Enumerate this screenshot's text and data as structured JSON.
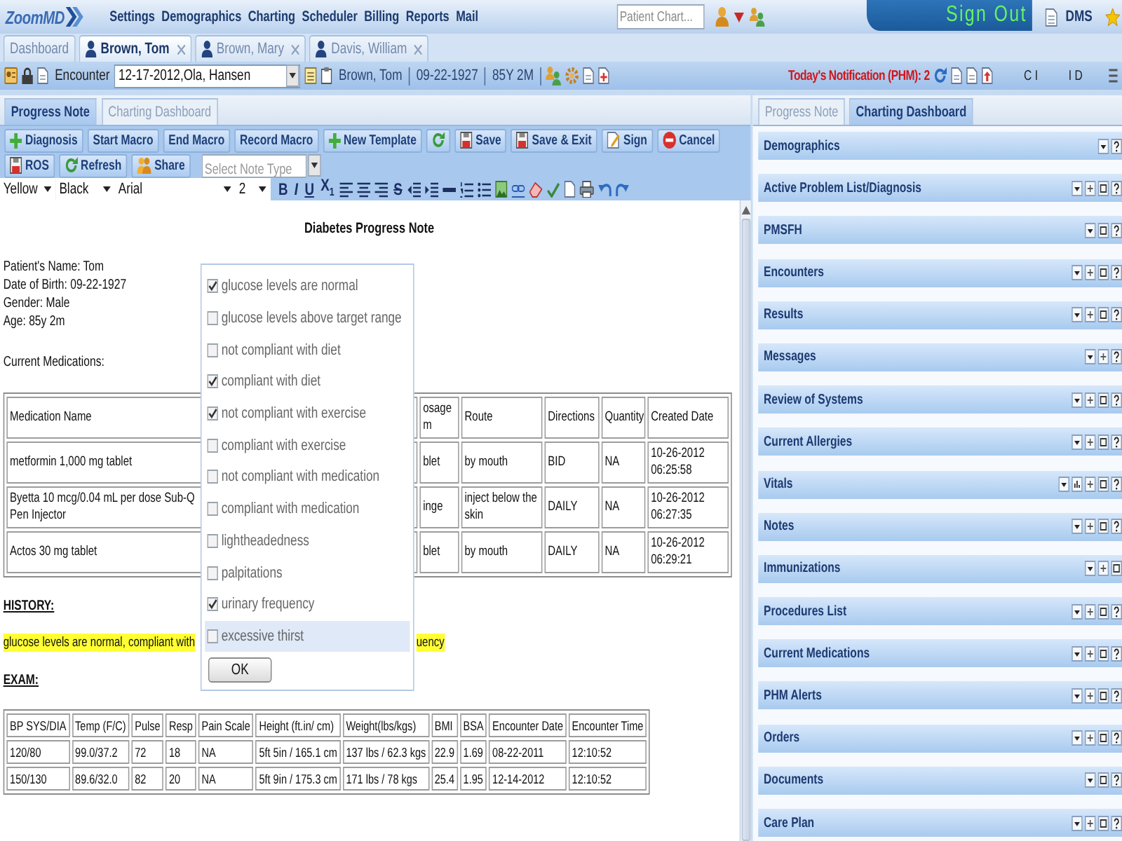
{
  "header": {
    "logo": "ZoomMD",
    "nav": [
      "Settings",
      "Demographics",
      "Charting",
      "Scheduler",
      "Billing",
      "Reports",
      "Mail"
    ],
    "search": {
      "placeholder": "Patient Chart..."
    },
    "sign_out": "Sign Out",
    "user": "DMS"
  },
  "patient_tabs": [
    {
      "label": "Dashboard",
      "kind": "dashboard",
      "selected": false
    },
    {
      "label": "Brown, Tom",
      "kind": "patient",
      "selected": true
    },
    {
      "label": "Brown, Mary",
      "kind": "patient",
      "selected": false
    },
    {
      "label": "Davis, William",
      "kind": "patient",
      "selected": false
    }
  ],
  "encounter_bar": {
    "label": "Encounter",
    "encounter": "12-17-2012,Ola, Hansen",
    "patient": "Brown, Tom",
    "birth_date": "09-22-1927",
    "age": "85Y 2M",
    "notification": "Today's Notification (PHM): 2",
    "codes": [
      "C I",
      "I D"
    ]
  },
  "note_tabs": [
    {
      "label": "Progress Note",
      "selected": true
    },
    {
      "label": "Charting Dashboard",
      "selected": false
    }
  ],
  "toolbar": [
    [
      {
        "label": "Diagnosis",
        "kind": "add"
      },
      {
        "label": "Start Macro",
        "kind": "plain"
      },
      {
        "label": "End Macro",
        "kind": "plain"
      },
      {
        "label": "Record Macro",
        "kind": "plain"
      },
      {
        "label": "New Template",
        "kind": "add"
      },
      {
        "kind": "reload"
      },
      {
        "label": "Save",
        "kind": "save"
      },
      {
        "label": "Save & Exit",
        "kind": "save"
      },
      {
        "label": "Sign",
        "kind": "sign"
      },
      {
        "label": "Cancel",
        "kind": "cancel"
      }
    ],
    [
      {
        "label": "ROS",
        "kind": "save"
      },
      {
        "label": "Refresh",
        "kind": "refresh"
      },
      {
        "label": "Share",
        "kind": "share"
      }
    ]
  ],
  "note_type": {
    "placeholder": "Select Note Type"
  },
  "format_bar": {
    "highlight": "Yellow",
    "text_color": "Black",
    "font": "Arial",
    "size": "2",
    "tools": [
      {
        "kind": "bold",
        "label": "B"
      },
      {
        "kind": "italic",
        "label": "I"
      },
      {
        "kind": "underline",
        "label": "U"
      },
      {
        "kind": "subscript",
        "label": "X$_{1}$"
      },
      {
        "kind": "align-left"
      },
      {
        "kind": "align-center"
      },
      {
        "kind": "align-right"
      },
      {
        "kind": "strike",
        "label": "S"
      },
      {
        "kind": "outdent"
      },
      {
        "kind": "indent"
      },
      {
        "kind": "rule"
      },
      {
        "kind": "numbered-list"
      },
      {
        "kind": "bullet-list"
      },
      {
        "kind": "image"
      },
      {
        "kind": "link"
      },
      {
        "kind": "clear-format"
      },
      {
        "kind": "spellcheck"
      },
      {
        "kind": "paste"
      },
      {
        "kind": "print"
      },
      {
        "kind": "undo"
      },
      {
        "kind": "redo"
      }
    ]
  },
  "document": {
    "title": "Diabetes Progress Note",
    "patient_info": [
      "Patient's Name: Tom",
      "Date of Birth: 09-22-1927",
      "Gender: Male",
      "Age: 85y 2m"
    ],
    "medications_label": "Current Medications:",
    "medications": {
      "columns": [
        "Medication Name",
        "osage m",
        "Route",
        "Directions",
        "Quantity",
        "Created Date"
      ],
      "rows": [
        [
          "metformin 1,000 mg tablet",
          "blet",
          "by mouth",
          "BID",
          "NA",
          "10-26-2012 06:25:58"
        ],
        [
          "Byetta 10 mcg/0.04 mL per dose Sub-Q Pen Injector",
          "inge",
          "inject below the skin",
          "DAILY",
          "NA",
          "10-26-2012 06:27:35"
        ],
        [
          "Actos 30 mg tablet",
          "blet",
          "by mouth",
          "DAILY",
          "NA",
          "10-26-2012 06:29:21"
        ]
      ]
    },
    "history_heading": "HISTORY:",
    "history_text": [
      "glucose levels are normal, compliant with",
      "uency"
    ],
    "exam_heading": "EXAM:",
    "vitals": {
      "columns": [
        "BP SYS/DIA",
        "Temp (F/C)",
        "Pulse",
        "Resp",
        "Pain Scale",
        "Height (ft.in/ cm)",
        "Weight(lbs/kgs)",
        "BMI",
        "BSA",
        "Encounter Date",
        "Encounter Time"
      ],
      "rows": [
        [
          "120/80",
          "99.0/37.2",
          "72",
          "18",
          "NA",
          "5ft 5in / 165.1 cm",
          "137 lbs / 62.3 kgs",
          "22.9",
          "1.69",
          "08-22-2011",
          "12:10:52"
        ],
        [
          "150/130",
          "89.6/32.0",
          "82",
          "20",
          "NA",
          "5ft 9in / 175.3 cm",
          "171 lbs / 78 kgs",
          "25.4",
          "1.95",
          "12-14-2012",
          "12:10:52"
        ]
      ]
    }
  },
  "popup": {
    "options": [
      {
        "label": "glucose levels are normal",
        "checked": true,
        "highlighted": false
      },
      {
        "label": "glucose levels above target range",
        "checked": false,
        "highlighted": false
      },
      {
        "label": "not compliant with diet",
        "checked": false,
        "highlighted": false
      },
      {
        "label": "compliant with diet",
        "checked": true,
        "highlighted": false
      },
      {
        "label": "not compliant with exercise",
        "checked": true,
        "highlighted": false
      },
      {
        "label": "compliant with exercise",
        "checked": false,
        "highlighted": false
      },
      {
        "label": "not compliant with medication",
        "checked": false,
        "highlighted": false
      },
      {
        "label": "compliant with medication",
        "checked": false,
        "highlighted": false
      },
      {
        "label": "lightheadedness",
        "checked": false,
        "highlighted": false
      },
      {
        "label": "palpitations",
        "checked": false,
        "highlighted": false
      },
      {
        "label": "urinary frequency",
        "checked": true,
        "highlighted": false
      },
      {
        "label": "excessive thirst",
        "checked": false,
        "highlighted": true
      }
    ],
    "button": "OK"
  },
  "dashboard_tabs": [
    {
      "label": "Progress Note",
      "selected": false
    },
    {
      "label": "Charting Dashboard",
      "selected": true
    }
  ],
  "sections": [
    {
      "title": "Demographics",
      "tools": [
        {
          "kind": "caret"
        },
        {
          "kind": "help"
        }
      ]
    },
    {
      "title": "Active Problem List/Diagnosis",
      "tools": [
        {
          "kind": "caret"
        },
        {
          "kind": "plus"
        },
        {
          "kind": "window"
        },
        {
          "kind": "help"
        }
      ]
    },
    {
      "title": "PMSFH",
      "tools": [
        {
          "kind": "caret"
        },
        {
          "kind": "window"
        },
        {
          "kind": "help"
        }
      ]
    },
    {
      "title": "Encounters",
      "tools": [
        {
          "kind": "caret"
        },
        {
          "kind": "plus"
        },
        {
          "kind": "window"
        },
        {
          "kind": "help"
        }
      ]
    },
    {
      "title": "Results",
      "tools": [
        {
          "kind": "caret"
        },
        {
          "kind": "plus"
        },
        {
          "kind": "window"
        },
        {
          "kind": "help"
        }
      ]
    },
    {
      "title": "Messages",
      "tools": [
        {
          "kind": "caret"
        },
        {
          "kind": "plus"
        },
        {
          "kind": "help"
        }
      ]
    },
    {
      "title": "Review of Systems",
      "tools": [
        {
          "kind": "caret"
        },
        {
          "kind": "plus"
        },
        {
          "kind": "window"
        },
        {
          "kind": "help"
        }
      ]
    },
    {
      "title": "Current Allergies",
      "tools": [
        {
          "kind": "caret"
        },
        {
          "kind": "plus"
        },
        {
          "kind": "window"
        },
        {
          "kind": "help"
        }
      ]
    },
    {
      "title": "Vitals",
      "tools": [
        {
          "kind": "caret"
        },
        {
          "kind": "chart"
        },
        {
          "kind": "plus"
        },
        {
          "kind": "window"
        },
        {
          "kind": "help"
        }
      ]
    },
    {
      "title": "Notes",
      "tools": [
        {
          "kind": "caret"
        },
        {
          "kind": "plus"
        },
        {
          "kind": "window"
        },
        {
          "kind": "help"
        }
      ]
    },
    {
      "title": "Immunizations",
      "tools": [
        {
          "kind": "caret"
        },
        {
          "kind": "plus"
        },
        {
          "kind": "window"
        }
      ]
    },
    {
      "title": "Procedures List",
      "tools": [
        {
          "kind": "caret"
        },
        {
          "kind": "plus"
        },
        {
          "kind": "window"
        },
        {
          "kind": "help"
        }
      ]
    },
    {
      "title": "Current Medications",
      "tools": [
        {
          "kind": "caret"
        },
        {
          "kind": "plus"
        },
        {
          "kind": "window"
        },
        {
          "kind": "help"
        }
      ]
    },
    {
      "title": "PHM Alerts",
      "tools": [
        {
          "kind": "caret"
        },
        {
          "kind": "plus"
        },
        {
          "kind": "window"
        },
        {
          "kind": "help"
        }
      ]
    },
    {
      "title": "Orders",
      "tools": [
        {
          "kind": "caret"
        },
        {
          "kind": "plus"
        },
        {
          "kind": "window"
        },
        {
          "kind": "help"
        }
      ]
    },
    {
      "title": "Documents",
      "tools": [
        {
          "kind": "caret"
        },
        {
          "kind": "window"
        },
        {
          "kind": "help"
        }
      ]
    },
    {
      "title": "Care Plan",
      "tools": [
        {
          "kind": "caret"
        },
        {
          "kind": "plus"
        },
        {
          "kind": "window"
        },
        {
          "kind": "help"
        }
      ]
    }
  ]
}
